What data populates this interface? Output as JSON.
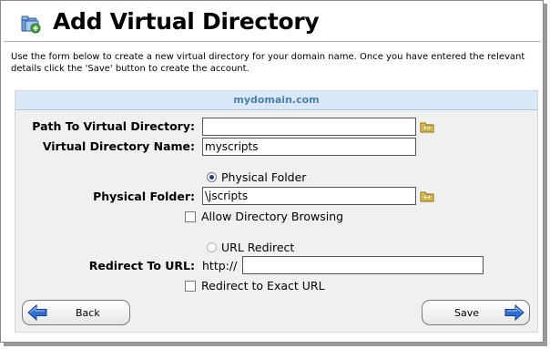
{
  "page": {
    "title": "Add Virtual Directory",
    "description": "Use the form below to create a new virtual directory for your domain name. Once you have entered the relevant details click the 'Save' button to create the account."
  },
  "panel": {
    "heading": "mydomain.com"
  },
  "form": {
    "path_label": "Path To Virtual Directory:",
    "path_value": "",
    "name_label": "Virtual Directory Name:",
    "name_value": "myscripts",
    "physical_folder_option": "Physical Folder",
    "physical_folder_selected": true,
    "physical_label": "Physical Folder:",
    "physical_value": "\\jscripts",
    "allow_browsing_label": "Allow Directory Browsing",
    "allow_browsing_checked": false,
    "url_redirect_option": "URL Redirect",
    "url_redirect_selected": false,
    "redirect_label": "Redirect To URL:",
    "redirect_prefix": "http://",
    "redirect_value": "",
    "exact_url_label": "Redirect to Exact URL",
    "exact_url_checked": false
  },
  "buttons": {
    "back_label": "Back",
    "save_label": "Save"
  },
  "icons": {
    "title": "virtual-directory-icon",
    "browse": "folder-browse-icon",
    "back": "arrow-left-icon",
    "save": "arrow-right-icon"
  },
  "colors": {
    "panel_header_bg": "#d9e9f7",
    "panel_header_text": "#4a7fb0",
    "panel_bg": "#f0f0f0",
    "arrow_blue": "#2f6fd0"
  }
}
